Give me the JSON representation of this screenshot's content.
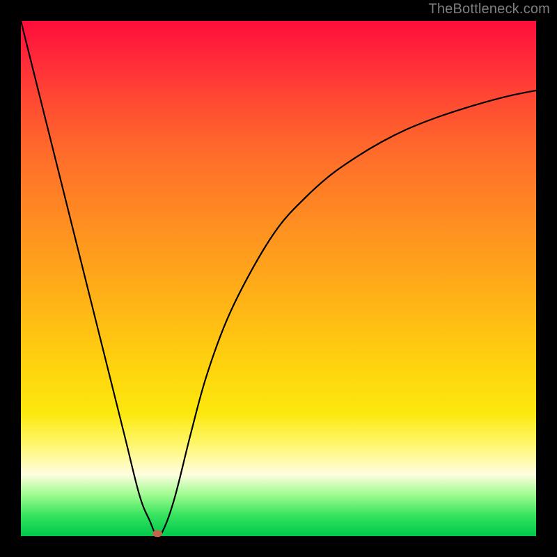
{
  "watermark": "TheBottleneck.com",
  "chart_data": {
    "type": "line",
    "title": "",
    "xlabel": "",
    "ylabel": "",
    "xlim": [
      0,
      100
    ],
    "ylim": [
      0,
      100
    ],
    "grid": false,
    "series": [
      {
        "name": "bottleneck-curve",
        "x": [
          0,
          5,
          10,
          15,
          20,
          23,
          25,
          26.5,
          28,
          30,
          33,
          36,
          40,
          45,
          50,
          55,
          60,
          65,
          70,
          75,
          80,
          85,
          90,
          95,
          100
        ],
        "values": [
          100,
          80,
          60,
          40,
          20,
          8,
          3,
          0,
          2,
          8,
          20,
          31,
          42,
          52,
          60,
          65.5,
          70,
          73.5,
          76.5,
          79,
          81,
          82.7,
          84.2,
          85.5,
          86.5
        ]
      }
    ],
    "marker": {
      "x": 26.5,
      "y": 0.5,
      "color": "#c1654c"
    },
    "gradient_stops": [
      {
        "pos": 0.0,
        "color": "#ff0d3a"
      },
      {
        "pos": 0.07,
        "color": "#ff283a"
      },
      {
        "pos": 0.15,
        "color": "#ff4833"
      },
      {
        "pos": 0.25,
        "color": "#ff6a2b"
      },
      {
        "pos": 0.38,
        "color": "#ff8b22"
      },
      {
        "pos": 0.52,
        "color": "#ffad18"
      },
      {
        "pos": 0.65,
        "color": "#ffce0f"
      },
      {
        "pos": 0.76,
        "color": "#fce80c"
      },
      {
        "pos": 0.82,
        "color": "#fff66a"
      },
      {
        "pos": 0.88,
        "color": "#fffde0"
      },
      {
        "pos": 0.92,
        "color": "#9efc8f"
      },
      {
        "pos": 0.96,
        "color": "#35e35e"
      },
      {
        "pos": 1.0,
        "color": "#00c84b"
      }
    ]
  }
}
